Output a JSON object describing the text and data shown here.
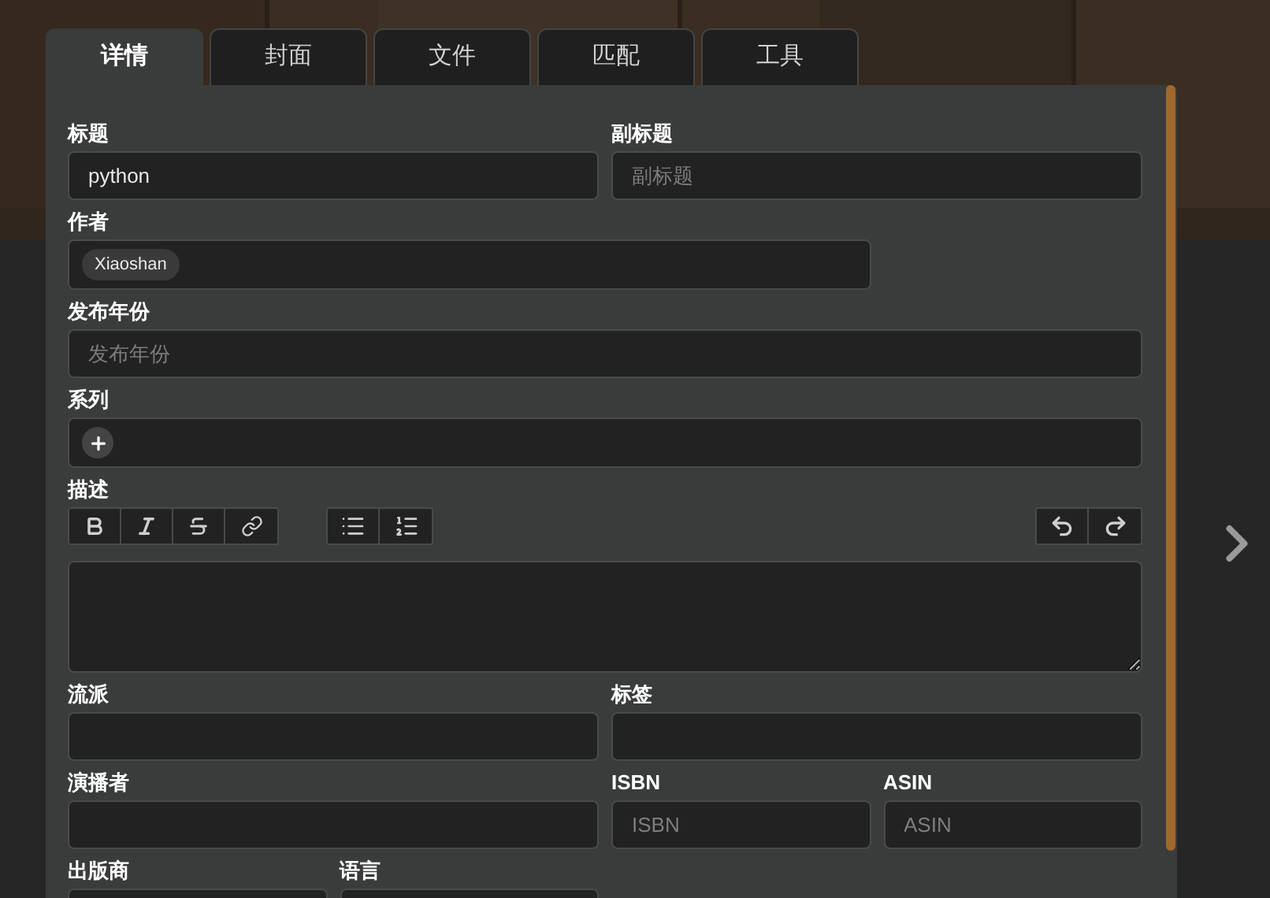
{
  "tabs": [
    {
      "label": "详情",
      "selected": true
    },
    {
      "label": "封面",
      "selected": false
    },
    {
      "label": "文件",
      "selected": false
    },
    {
      "label": "匹配",
      "selected": false
    },
    {
      "label": "工具",
      "selected": false
    }
  ],
  "rows": [
    [
      {
        "kind": "text",
        "label": "标题",
        "value": "python"
      },
      {
        "kind": "text",
        "label": "副标题",
        "placeholder": "副标题"
      }
    ],
    [
      {
        "kind": "chips",
        "label": "作者",
        "chips": [
          "Xiaoshan"
        ]
      }
    ],
    [
      {
        "kind": "text",
        "label": "发布年份",
        "placeholder": "发布年份"
      }
    ],
    [
      {
        "kind": "add",
        "label": "系列"
      }
    ],
    [
      {
        "kind": "editor",
        "label": "描述"
      }
    ],
    [
      {
        "kind": "text",
        "label": "流派"
      },
      {
        "kind": "text",
        "label": "标签"
      }
    ],
    [
      {
        "kind": "text",
        "label": "演播者"
      },
      {
        "kind": "text",
        "label": "ISBN",
        "placeholder": "ISBN"
      },
      {
        "kind": "text",
        "label": "ASIN",
        "placeholder": "ASIN"
      }
    ],
    [
      {
        "kind": "text",
        "label": "出版商"
      },
      {
        "kind": "text",
        "label": "语言"
      }
    ]
  ]
}
